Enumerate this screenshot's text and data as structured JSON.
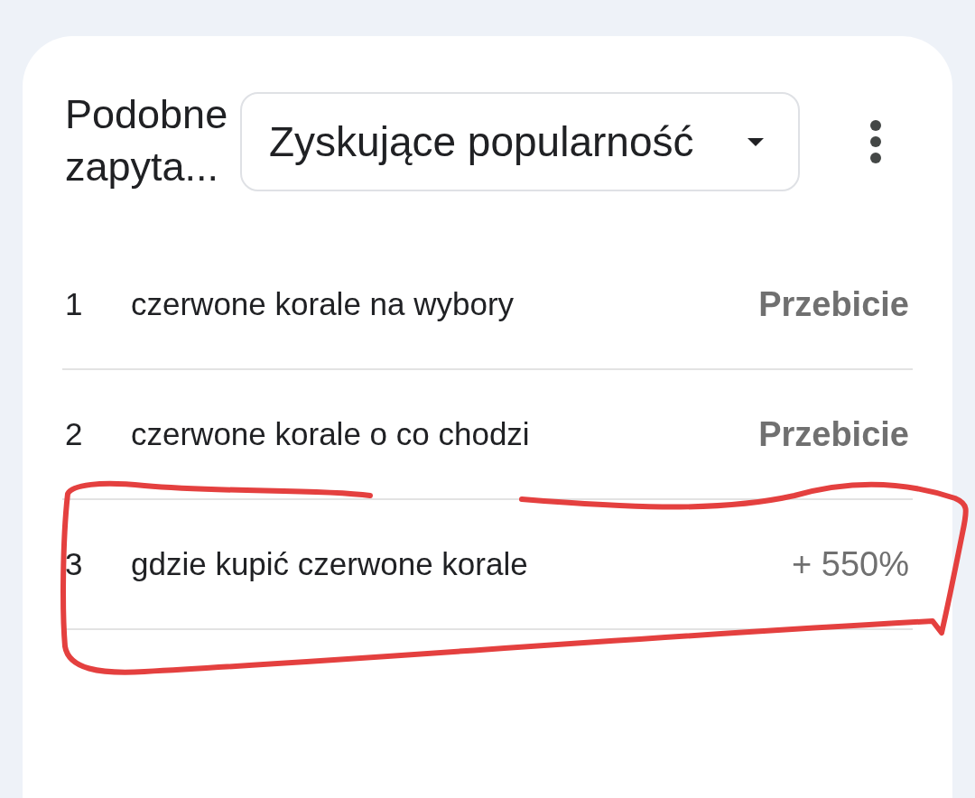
{
  "header": {
    "title": "Podobne zapyta...",
    "dropdown": {
      "value": "Zyskujące popularność"
    }
  },
  "rows": [
    {
      "rank": "1",
      "query": "czerwone korale na wybory",
      "value": "Przebicie",
      "kind": "breakout",
      "circled": false
    },
    {
      "rank": "2",
      "query": "czerwone korale o co chodzi",
      "value": "Przebicie",
      "kind": "breakout",
      "circled": false
    },
    {
      "rank": "3",
      "query": "gdzie kupić czerwone korale",
      "value": "+ 550%",
      "kind": "percent",
      "circled": true
    }
  ]
}
